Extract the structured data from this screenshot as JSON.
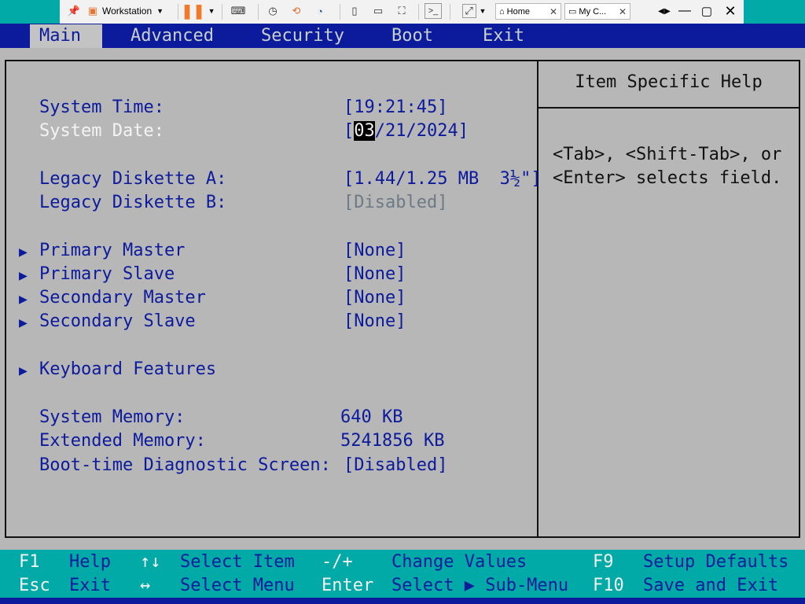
{
  "toolbar": {
    "vm_dropdown_label": "Workstation",
    "tabs": [
      {
        "label": "Home"
      },
      {
        "label": "My C..."
      }
    ]
  },
  "menu": {
    "items": [
      "Main",
      "Advanced",
      "Security",
      "Boot",
      "Exit"
    ],
    "active": "Main"
  },
  "main": {
    "system_time_label": "System Time:",
    "system_time_value": "[19:21:45]",
    "system_date_label": "System Date:",
    "system_date_open": "[",
    "system_date_cursor": "03",
    "system_date_rest": "/21/2024]",
    "diskette_a_label": "Legacy Diskette A:",
    "diskette_a_value": "[1.44/1.25 MB  3½\"]",
    "diskette_b_label": "Legacy Diskette B:",
    "diskette_b_value": "[Disabled]",
    "submenus": [
      {
        "label": "Primary Master",
        "value": "[None]"
      },
      {
        "label": "Primary Slave",
        "value": "[None]"
      },
      {
        "label": "Secondary Master",
        "value": "[None]"
      },
      {
        "label": "Secondary Slave",
        "value": "[None]"
      }
    ],
    "keyboard_features_label": "Keyboard Features",
    "system_memory_label": "System Memory:",
    "system_memory_value": "640 KB",
    "extended_memory_label": "Extended Memory:",
    "extended_memory_value": "5241856 KB",
    "boot_diag_label": "Boot-time Diagnostic Screen:",
    "boot_diag_value": "[Disabled]"
  },
  "help": {
    "title": "Item Specific Help",
    "text": "<Tab>, <Shift-Tab>, or\n<Enter> selects field."
  },
  "footer": {
    "row1": [
      {
        "key": "F1",
        "desc": "Help"
      },
      {
        "key": "↑↓",
        "desc": "Select Item"
      },
      {
        "key": "-/+",
        "desc": "Change Values"
      },
      {
        "key": "F9",
        "desc": "Setup Defaults"
      }
    ],
    "row2": [
      {
        "key": "Esc",
        "desc": "Exit"
      },
      {
        "key": "↔",
        "desc": "Select Menu"
      },
      {
        "key": "Enter",
        "desc": "Select ▶ Sub-Menu"
      },
      {
        "key": "F10",
        "desc": "Save and Exit"
      }
    ]
  },
  "colors": {
    "bios_blue": "#0c1a9c",
    "bios_gray": "#b7b7b7",
    "footer_cyan": "#01aaa6",
    "selected_text": "#f4f4f4"
  },
  "icons": {
    "submenu_marker": "triangle-right-icon"
  }
}
